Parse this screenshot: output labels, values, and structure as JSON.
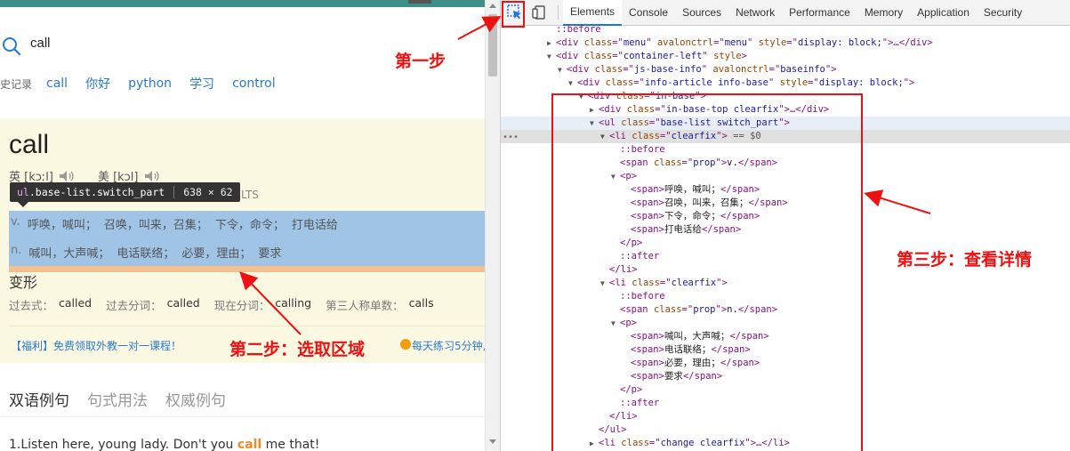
{
  "page": {
    "search": {
      "value": "call"
    },
    "history": {
      "label": "史记录",
      "items": [
        "call",
        "你好",
        "python",
        "学习",
        "control"
      ]
    },
    "word": {
      "headword": "call",
      "uk_label": "英 [kɔːl]",
      "us_label": "美 [kɔl]",
      "exam_tag": "/ IELTS"
    },
    "tooltip": {
      "tag": "ul",
      "classes": ".base-list.switch_part",
      "size": "638 × 62"
    },
    "definitions": [
      {
        "pos": "v.",
        "meanings": [
          "呼唤，喊叫；",
          "召唤，叫来，召集；",
          "下令，命令；",
          "打电话给"
        ]
      },
      {
        "pos": "n.",
        "meanings": [
          "喊叫，大声喊；",
          "电话联络；",
          "必要，理由；",
          "要求"
        ]
      }
    ],
    "forms": {
      "title": "变形",
      "items": [
        {
          "label": "过去式：",
          "value": "called"
        },
        {
          "label": "过去分词：",
          "value": "called"
        },
        {
          "label": "现在分词：",
          "value": "calling"
        },
        {
          "label": "第三人称单数：",
          "value": "calls"
        }
      ]
    },
    "promo": {
      "left": "【福利】免费领取外教一对一课程！",
      "right": "每天练习5分钟,"
    },
    "tabs": [
      "双语例句",
      "句式用法",
      "权威例句"
    ],
    "example": {
      "prefix": "1.Listen here, young lady. Don't you ",
      "keyword": "call",
      "suffix": " me that!"
    }
  },
  "devtools": {
    "tabs": [
      "Elements",
      "Console",
      "Sources",
      "Network",
      "Performance",
      "Memory",
      "Application",
      "Security"
    ],
    "active_tab": "Elements"
  },
  "dom": [
    {
      "depth": 4,
      "tw": "",
      "kind": "pseudo",
      "text": "::before"
    },
    {
      "depth": 4,
      "tw": "▶",
      "kind": "el",
      "tag": "div",
      "attrs": [
        [
          "class",
          "menu"
        ],
        [
          "avalonctrl",
          "menu"
        ],
        [
          "style",
          "display: block;"
        ]
      ],
      "tail": "…</div>"
    },
    {
      "depth": 4,
      "tw": "▼",
      "kind": "el",
      "tag": "div",
      "attrs": [
        [
          "class",
          "container-left"
        ],
        [
          "style",
          null
        ]
      ],
      "tail": ""
    },
    {
      "depth": 5,
      "tw": "▼",
      "kind": "el",
      "tag": "div",
      "attrs": [
        [
          "class",
          "js-base-info"
        ],
        [
          "avalonctrl",
          "baseinfo"
        ]
      ],
      "tail": ""
    },
    {
      "depth": 6,
      "tw": "▼",
      "kind": "el",
      "tag": "div",
      "attrs": [
        [
          "class",
          "info-article info-base"
        ],
        [
          "style",
          "display: block;"
        ]
      ],
      "tail": ""
    },
    {
      "depth": 7,
      "tw": "▼",
      "kind": "el",
      "tag": "div",
      "attrs": [
        [
          "class",
          "in-base"
        ]
      ],
      "tail": ""
    },
    {
      "depth": 8,
      "tw": "▶",
      "kind": "el",
      "tag": "div",
      "attrs": [
        [
          "class",
          "in-base-top clearfix"
        ]
      ],
      "tail": "…</div>"
    },
    {
      "depth": 8,
      "tw": "▼",
      "kind": "el",
      "tag": "ul",
      "attrs": [
        [
          "class",
          "base-list switch_part"
        ]
      ],
      "tail": "",
      "hov": true
    },
    {
      "depth": 9,
      "tw": "▼",
      "kind": "el",
      "tag": "li",
      "attrs": [
        [
          "class",
          "clearfix"
        ]
      ],
      "tail": "",
      "eq": " == $0",
      "sel": true
    },
    {
      "depth": 10,
      "tw": "",
      "kind": "pseudo",
      "text": "::before"
    },
    {
      "depth": 10,
      "tw": "",
      "kind": "el",
      "tag": "span",
      "attrs": [
        [
          "class",
          "prop"
        ]
      ],
      "text": "v.",
      "close": "span"
    },
    {
      "depth": 10,
      "tw": "▼",
      "kind": "el",
      "tag": "p",
      "attrs": [],
      "tail": ""
    },
    {
      "depth": 11,
      "tw": "",
      "kind": "el",
      "tag": "span",
      "attrs": [],
      "text": "呼唤，喊叫；",
      "close": "span"
    },
    {
      "depth": 11,
      "tw": "",
      "kind": "el",
      "tag": "span",
      "attrs": [],
      "text": "召唤，叫来，召集；",
      "close": "span"
    },
    {
      "depth": 11,
      "tw": "",
      "kind": "el",
      "tag": "span",
      "attrs": [],
      "text": "下令，命令；",
      "close": "span"
    },
    {
      "depth": 11,
      "tw": "",
      "kind": "el",
      "tag": "span",
      "attrs": [],
      "text": "打电话给",
      "close": "span"
    },
    {
      "depth": 10,
      "tw": "",
      "kind": "close",
      "tag": "p"
    },
    {
      "depth": 10,
      "tw": "",
      "kind": "pseudo",
      "text": "::after"
    },
    {
      "depth": 9,
      "tw": "",
      "kind": "close",
      "tag": "li"
    },
    {
      "depth": 9,
      "tw": "▼",
      "kind": "el",
      "tag": "li",
      "attrs": [
        [
          "class",
          "clearfix"
        ]
      ],
      "tail": ""
    },
    {
      "depth": 10,
      "tw": "",
      "kind": "pseudo",
      "text": "::before"
    },
    {
      "depth": 10,
      "tw": "",
      "kind": "el",
      "tag": "span",
      "attrs": [
        [
          "class",
          "prop"
        ]
      ],
      "text": "n.",
      "close": "span"
    },
    {
      "depth": 10,
      "tw": "▼",
      "kind": "el",
      "tag": "p",
      "attrs": [],
      "tail": ""
    },
    {
      "depth": 11,
      "tw": "",
      "kind": "el",
      "tag": "span",
      "attrs": [],
      "text": "喊叫，大声喊；",
      "close": "span"
    },
    {
      "depth": 11,
      "tw": "",
      "kind": "el",
      "tag": "span",
      "attrs": [],
      "text": "电话联络；",
      "close": "span"
    },
    {
      "depth": 11,
      "tw": "",
      "kind": "el",
      "tag": "span",
      "attrs": [],
      "text": "必要，理由；",
      "close": "span"
    },
    {
      "depth": 11,
      "tw": "",
      "kind": "el",
      "tag": "span",
      "attrs": [],
      "text": "要求",
      "close": "span"
    },
    {
      "depth": 10,
      "tw": "",
      "kind": "close",
      "tag": "p"
    },
    {
      "depth": 10,
      "tw": "",
      "kind": "pseudo",
      "text": "::after"
    },
    {
      "depth": 9,
      "tw": "",
      "kind": "close",
      "tag": "li"
    },
    {
      "depth": 8,
      "tw": "",
      "kind": "close",
      "tag": "ul"
    },
    {
      "depth": 8,
      "tw": "▶",
      "kind": "el",
      "tag": "li",
      "attrs": [
        [
          "class",
          "change clearfix"
        ]
      ],
      "tail": "…</li>"
    }
  ],
  "annotations": {
    "step1": "第一步",
    "step2": "第二步：选取区域",
    "step3": "第三步：查看详情",
    "color": "#e11111"
  },
  "colors": {
    "highlight": "#9fc4e6",
    "card_bg": "#fcf9e3",
    "link": "#2a7ad0",
    "accent_keyword": "#f08a24"
  }
}
